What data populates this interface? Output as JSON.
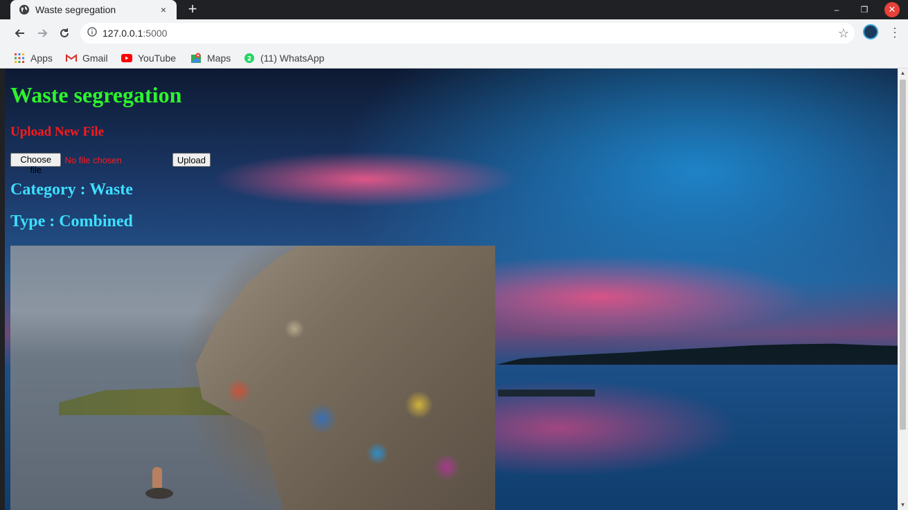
{
  "browser": {
    "tab": {
      "title": "Waste segregation",
      "close_icon": "×"
    },
    "new_tab_icon": "+",
    "window_controls": {
      "minimize": "–",
      "maximize": "❐",
      "close": "✕"
    },
    "address": {
      "host": "127.0.0.1",
      "port": ":5000"
    },
    "bookmarks": [
      {
        "label": "Apps",
        "icon": "apps-grid-icon"
      },
      {
        "label": "Gmail",
        "icon": "gmail-icon"
      },
      {
        "label": "YouTube",
        "icon": "youtube-icon"
      },
      {
        "label": "Maps",
        "icon": "maps-icon"
      },
      {
        "label": "(11) WhatsApp",
        "icon": "whatsapp-icon",
        "badge": "2"
      }
    ]
  },
  "page": {
    "heading": "Waste segregation",
    "upload_heading": "Upload New File",
    "file_input": {
      "button_label": "Choose file",
      "status": "No file chosen"
    },
    "upload_button": "Upload",
    "category_line": "Category : Waste",
    "type_line": "Type : Combined"
  },
  "colors": {
    "heading": "#2cf52c",
    "upload_heading": "#ff1a1a",
    "result_text": "#3de0ff"
  }
}
